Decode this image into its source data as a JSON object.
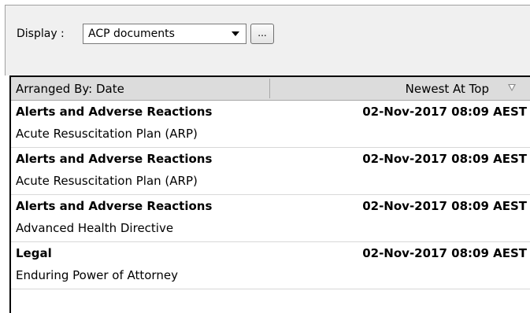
{
  "toolbar": {
    "display_label": "Display :",
    "display_value": "ACP documents",
    "ellipsis_label": "..."
  },
  "list": {
    "header_left": "Arranged By: Date",
    "header_right": "Newest At Top",
    "items": [
      {
        "title": "Alerts and Adverse Reactions",
        "date": "02-Nov-2017 08:09 AEST",
        "subtitle": "Acute Resuscitation Plan (ARP)"
      },
      {
        "title": "Alerts and Adverse Reactions",
        "date": "02-Nov-2017 08:09 AEST",
        "subtitle": "Acute Resuscitation Plan (ARP)"
      },
      {
        "title": "Alerts and Adverse Reactions",
        "date": "02-Nov-2017 08:09 AEST",
        "subtitle": "Advanced Health Directive"
      },
      {
        "title": "Legal",
        "date": "02-Nov-2017 08:09 AEST",
        "subtitle": "Enduring Power of Attorney"
      }
    ]
  },
  "icons": {
    "combo_arrow": "dropdown-arrow-icon",
    "sort": "sort-descending-icon"
  }
}
